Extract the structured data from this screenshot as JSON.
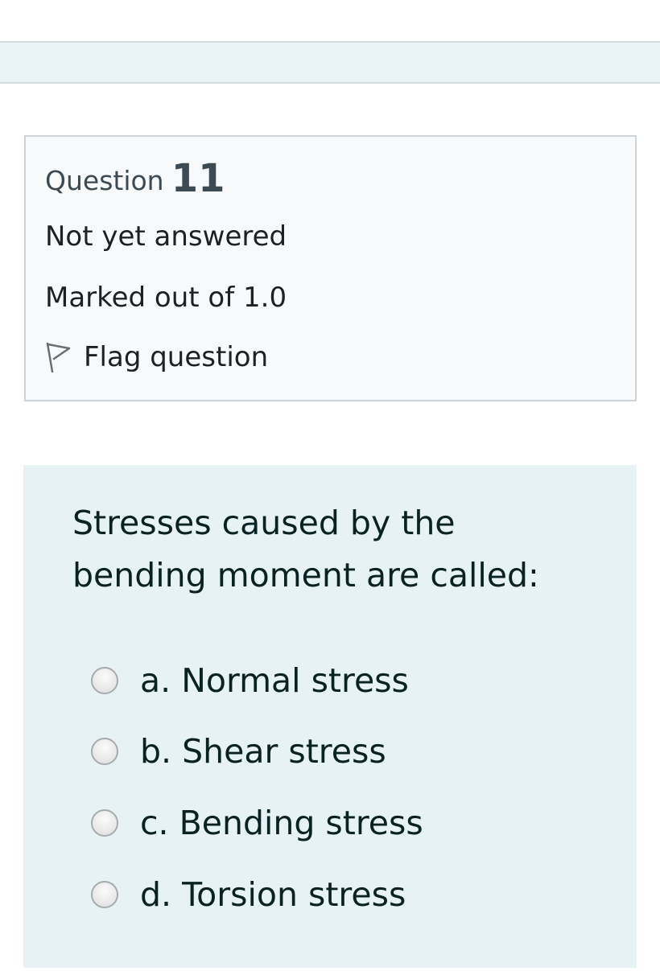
{
  "info": {
    "question_word": "Question",
    "question_number": "11",
    "state": "Not yet answered",
    "mark": "Marked out of 1.0",
    "flag_label": "Flag question",
    "flag_icon": "flag-outline-icon"
  },
  "question": {
    "text": "Stresses caused by the bending moment are called:",
    "options": [
      {
        "letter": "a.",
        "label": "a. Normal stress"
      },
      {
        "letter": "b.",
        "label": "b. Shear stress"
      },
      {
        "letter": "c.",
        "label": "c. Bending stress"
      },
      {
        "letter": "d.",
        "label": "d. Torsion stress"
      }
    ]
  },
  "colors": {
    "banner_bg": "#eaf3f6",
    "info_bg": "#f8f9fa",
    "question_bg": "#e7f2f4",
    "heading_text": "#3c4a54",
    "question_text": "#0b2224"
  }
}
